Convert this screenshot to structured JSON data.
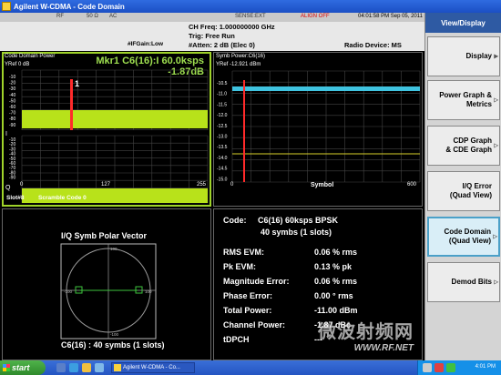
{
  "window": {
    "title": "Agilent W-CDMA - Code Domain"
  },
  "status": {
    "rf": "RF",
    "impedance": "50 Ω",
    "coupling": "AC",
    "sense": "SENSE:EXT",
    "warning": "ALIGN OFF",
    "datetime": "04:01:58 PM Sep 05, 2011"
  },
  "info": {
    "ch_freq": "CH Freq: 1.000000000 GHz",
    "trig": "Trig: Free Run",
    "if_gain": "#IFGain:Low",
    "atten": "#Atten: 2 dB (Elec 0)",
    "radio_device": "Radio Device: MS"
  },
  "cdp": {
    "title": "Code Domain Power",
    "yref": "YRef  0 dB",
    "marker_line1": "Mkr1 C6(16):I 60.0ksps",
    "marker_line2": "-1.87dB",
    "marker_num": "1",
    "y_ticks_i": [
      "-10",
      "-20",
      "-30",
      "-40",
      "-50",
      "-60",
      "-70",
      "-80",
      "-90"
    ],
    "y_ticks_q": [
      "-10",
      "-20",
      "-30",
      "-40",
      "-50",
      "-60",
      "-70",
      "-80",
      "-90"
    ],
    "i_label": "I",
    "q_label": "Q",
    "x_ticks": [
      "0",
      "127",
      "255"
    ],
    "slot": "Slot#8",
    "scramble": "Scramble Code 0"
  },
  "symb": {
    "title": "Symb Power:C6(16)",
    "yref": "YRef  -12.921 dBm",
    "y_ticks": [
      "-10.5",
      "-11.0",
      "-11.5",
      "-12.0",
      "-12.5",
      "-13.0",
      "-13.5",
      "-14.0",
      "-14.5",
      "-15.0"
    ],
    "x_ticks": [
      "0",
      "600"
    ],
    "x_label": "Symbol"
  },
  "iq": {
    "title": "I/Q Symb Polar Vector",
    "caption": "C6(16) : 40 symbs (1 slots)",
    "tick_left": "-100",
    "tick_right": "100",
    "tick_top": "100",
    "tick_bottom": "-100"
  },
  "metrics": {
    "code_label": "Code:",
    "code_value": "C6(16) 60ksps BPSK",
    "symbs": "40 symbs (1 slots)",
    "rows": [
      {
        "label": "RMS EVM:",
        "value": "0.06 % rms"
      },
      {
        "label": "Pk EVM:",
        "value": "0.13 % pk"
      },
      {
        "label": "Magnitude Error:",
        "value": "0.06 % rms"
      },
      {
        "label": "Phase Error:",
        "value": "0.00 ° rms"
      },
      {
        "label": "Total Power:",
        "value": "-11.00 dBm"
      },
      {
        "label": "Channel Power:",
        "value": "-1.87 dBc"
      },
      {
        "label": "tDPCH",
        "value": "---"
      }
    ]
  },
  "softkeys": {
    "title": "View/Display",
    "keys": [
      {
        "label": "Display"
      },
      {
        "label": "Power Graph &\nMetrics"
      },
      {
        "label": "CDP Graph\n& CDE Graph"
      },
      {
        "label": "I/Q Error\n(Quad View)"
      },
      {
        "label": "Code Domain\n(Quad View)"
      },
      {
        "label": "Demod Bits"
      }
    ]
  },
  "taskbar": {
    "start": "start",
    "task": "Agilent W-CDMA - Co...",
    "clock": "4:01 PM"
  },
  "watermark": {
    "cn": "微波射频网",
    "url": "WWW.RF.NET"
  },
  "colors": {
    "trace": "#b8e21a",
    "marker": "#ff2a2a",
    "symb_trace": "#3fc3e0",
    "accent": "#9fd32a"
  }
}
